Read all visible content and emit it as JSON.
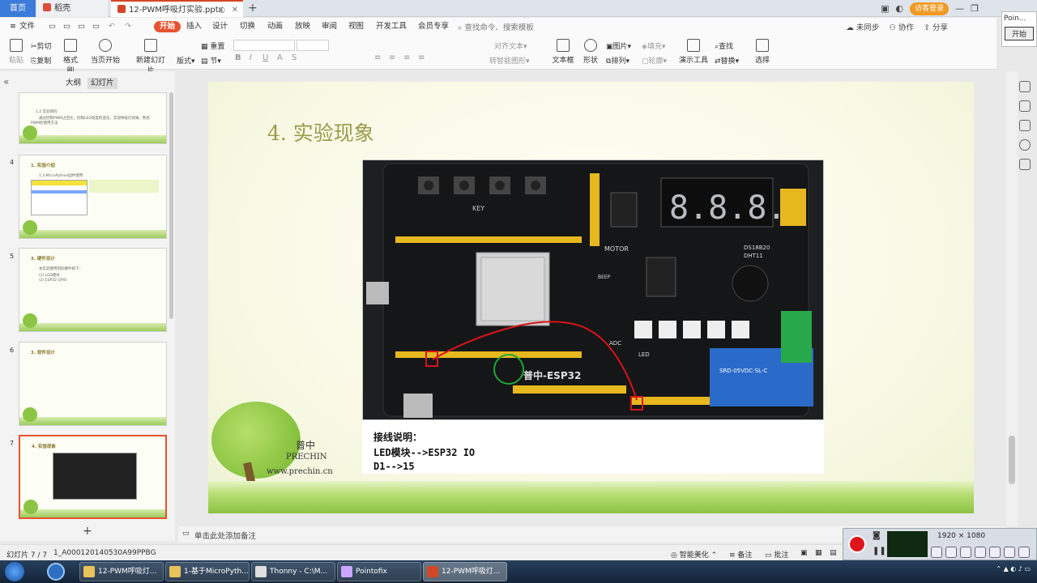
{
  "tabs": {
    "home": "首页",
    "doc1": "稻壳",
    "doc2": "12-PWM呼吸灯实验.pptx",
    "new_tab": "+"
  },
  "topright": {
    "login": "访客登录"
  },
  "mini_pane": {
    "title": "Poin...",
    "button": "开始"
  },
  "menu": {
    "file": "文件",
    "items": [
      "开始",
      "插入",
      "设计",
      "切换",
      "动画",
      "放映",
      "审阅",
      "视图",
      "开发工具",
      "会员专享"
    ],
    "search": "查找命令、搜索模板",
    "sync": "未同步",
    "collab": "协作",
    "share": "分享"
  },
  "toolbar": {
    "paste": "粘贴",
    "cut": "剪切",
    "copy": "复制",
    "format_painter": "格式刷",
    "from_current": "当页开始",
    "new_slide": "新建幻灯片",
    "layout": "版式",
    "section": "节",
    "reset": "重置",
    "align_text": "对齐文本",
    "convert_smartart": "转智能图形",
    "textbox": "文本框",
    "shape": "形状",
    "picture": "图片",
    "fill": "填充",
    "arrange": "排列",
    "outline": "轮廓",
    "presentation_tools": "演示工具",
    "find": "查找",
    "replace": "替换",
    "select": "选择"
  },
  "left_panel": {
    "collapse": "«",
    "tab_outline": "大纲",
    "tab_slides": "幻灯片",
    "add": "+",
    "slides": [
      {
        "num": "",
        "title": "",
        "lines": [
          "1.2 实验目的",
          "通过控制PWM占空比，控制LED亮度的变化，实现呼吸灯效果。熟悉",
          "PWM的使用方法"
        ]
      },
      {
        "num": "4",
        "title": "1. 实验介绍",
        "lines": [
          "1.3 MicroPython固件使用"
        ]
      },
      {
        "num": "5",
        "title": "3. 硬件设计",
        "lines": [
          "本实验使用到的硬件如下：",
          "(1) LED模块",
          "(2) ESP32 GPIO"
        ]
      },
      {
        "num": "6",
        "title": "3. 软件设计",
        "lines": []
      },
      {
        "num": "7",
        "title": "4. 实验现象",
        "lines": []
      }
    ]
  },
  "slide": {
    "title": "4. 实验现象",
    "caption": [
      "接线说明：",
      "LED模块-->ESP32 IO",
      "D1-->15"
    ],
    "logo_cn": "普中",
    "logo_en": "PRECHIN",
    "logo_url": "www.prechin.cn",
    "board_labels": {
      "key": "KEY",
      "motor": "MOTOR",
      "led": "LED",
      "adc": "ADC",
      "esp32": "普中-ESP32",
      "digits": "8.8.8.8",
      "ds18b20": "DS18B20",
      "dht11": "DHT11",
      "beep": "BEEP",
      "relay": "SRD-05VDC-SL-C"
    }
  },
  "notes": {
    "placeholder": "单击此处添加备注"
  },
  "status": {
    "slide": "幻灯片 7 / 7",
    "id": "1_A000120140530A99PPBG",
    "beautify": "智能美化",
    "notes": "备注",
    "comment": "批注"
  },
  "recorder": {
    "resolution": "1920 × 1080"
  },
  "taskbar": {
    "items": [
      "12-PWM呼吸灯...",
      "1-基于MicroPyth...",
      "Thonny - C:\\M...",
      "Pointofix",
      "12-PWM呼吸灯..."
    ]
  },
  "colors": {
    "accent": "#e7532f",
    "slide_title": "#9c9a4b",
    "wire": "#d8141a"
  }
}
